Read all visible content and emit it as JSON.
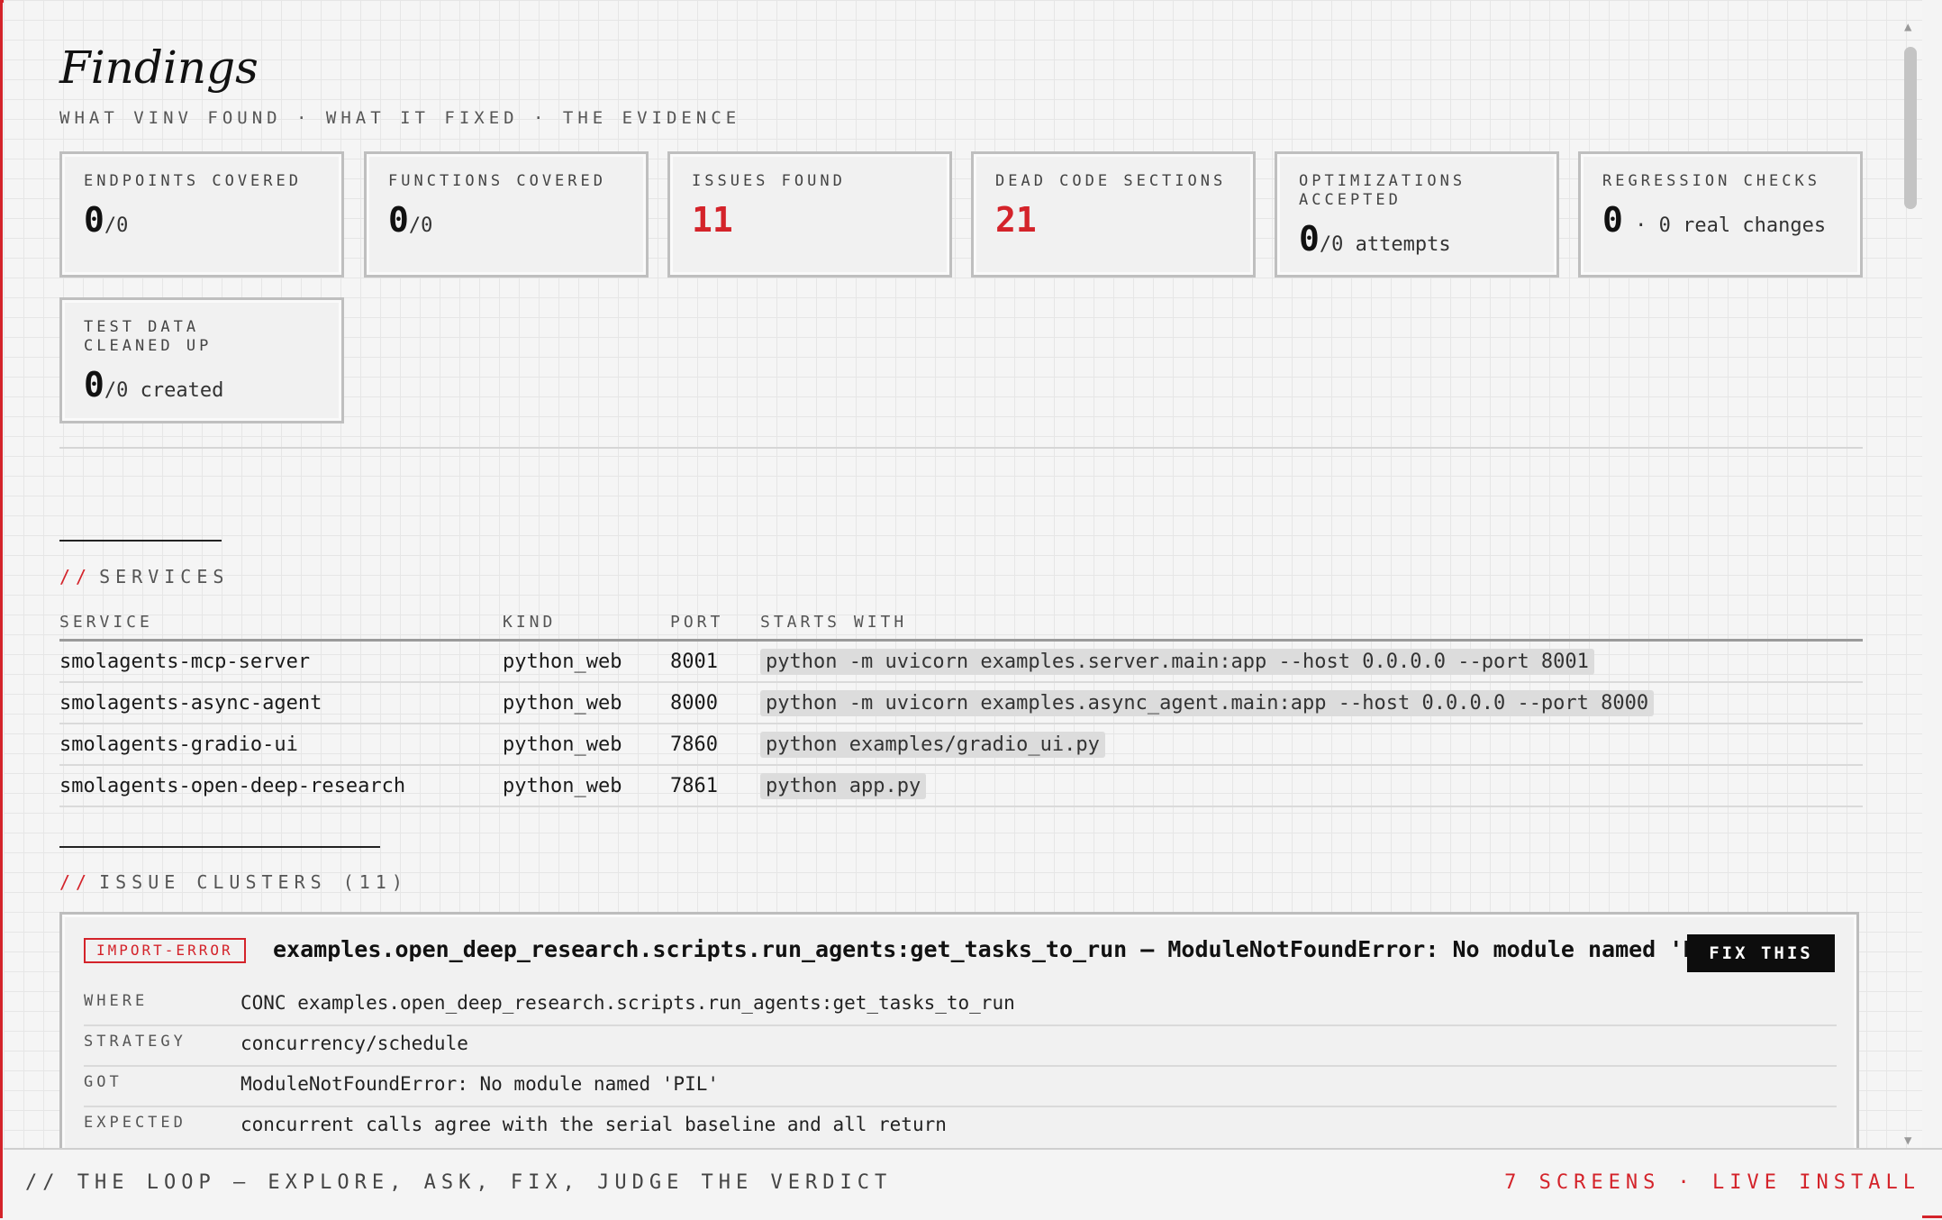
{
  "header": {
    "title": "Findings",
    "subtitle": "WHAT VINV FOUND · WHAT IT FIXED · THE EVIDENCE"
  },
  "stats": [
    {
      "label": "ENDPOINTS COVERED",
      "value": "0",
      "suffix": "/0"
    },
    {
      "label": "FUNCTIONS COVERED",
      "value": "0",
      "suffix": "/0"
    },
    {
      "label": "ISSUES FOUND",
      "value": "11",
      "suffix": ""
    },
    {
      "label": "DEAD CODE SECTIONS",
      "value": "21",
      "suffix": ""
    },
    {
      "label": "OPTIMIZATIONS ACCEPTED",
      "value": "0",
      "suffix": "/0 attempts"
    },
    {
      "label": "REGRESSION CHECKS",
      "value": "0",
      "suffix": " · 0 real changes"
    },
    {
      "label": "TEST DATA CLEANED UP",
      "value": "0",
      "suffix": "/0 created"
    }
  ],
  "services": {
    "section_slashes": "//",
    "section_title": "SERVICES",
    "columns": [
      "SERVICE",
      "KIND",
      "PORT",
      "STARTS WITH"
    ],
    "rows": [
      {
        "service": "smolagents-mcp-server",
        "kind": "python_web",
        "port": "8001",
        "command": "python -m uvicorn examples.server.main:app --host 0.0.0.0 --port 8001"
      },
      {
        "service": "smolagents-async-agent",
        "kind": "python_web",
        "port": "8000",
        "command": "python -m uvicorn examples.async_agent.main:app --host 0.0.0.0 --port 8000"
      },
      {
        "service": "smolagents-gradio-ui",
        "kind": "python_web",
        "port": "7860",
        "command": "python examples/gradio_ui.py"
      },
      {
        "service": "smolagents-open-deep-research",
        "kind": "python_web",
        "port": "7861",
        "command": "python app.py"
      }
    ]
  },
  "issues": {
    "section_slashes": "//",
    "section_title": "ISSUE CLUSTERS (11)",
    "first": {
      "tag": "IMPORT-ERROR",
      "title": "examples.open_deep_research.scripts.run_agents:get_tasks_to_run — ModuleNotFoundError: No module named 'PIL'",
      "fix_label": "FIX THIS",
      "details": [
        {
          "key": "WHERE",
          "value": "CONC examples.open_deep_research.scripts.run_agents:get_tasks_to_run"
        },
        {
          "key": "STRATEGY",
          "value": "concurrency/schedule"
        },
        {
          "key": "GOT",
          "value": "ModuleNotFoundError: No module named 'PIL'"
        },
        {
          "key": "EXPECTED",
          "value": "concurrent calls agree with the serial baseline and all return"
        }
      ]
    }
  },
  "footer": {
    "left": "// THE LOOP — EXPLORE, ASK, FIX, JUDGE THE VERDICT",
    "right": "7 SCREENS · LIVE INSTALL"
  },
  "colors": {
    "accent": "#d4232a",
    "text": "#1a1a1a",
    "background": "#f5f5f5"
  },
  "icons": {
    "scroll_up": "scroll-up-arrow-icon",
    "scroll_down": "scroll-down-arrow-icon"
  }
}
